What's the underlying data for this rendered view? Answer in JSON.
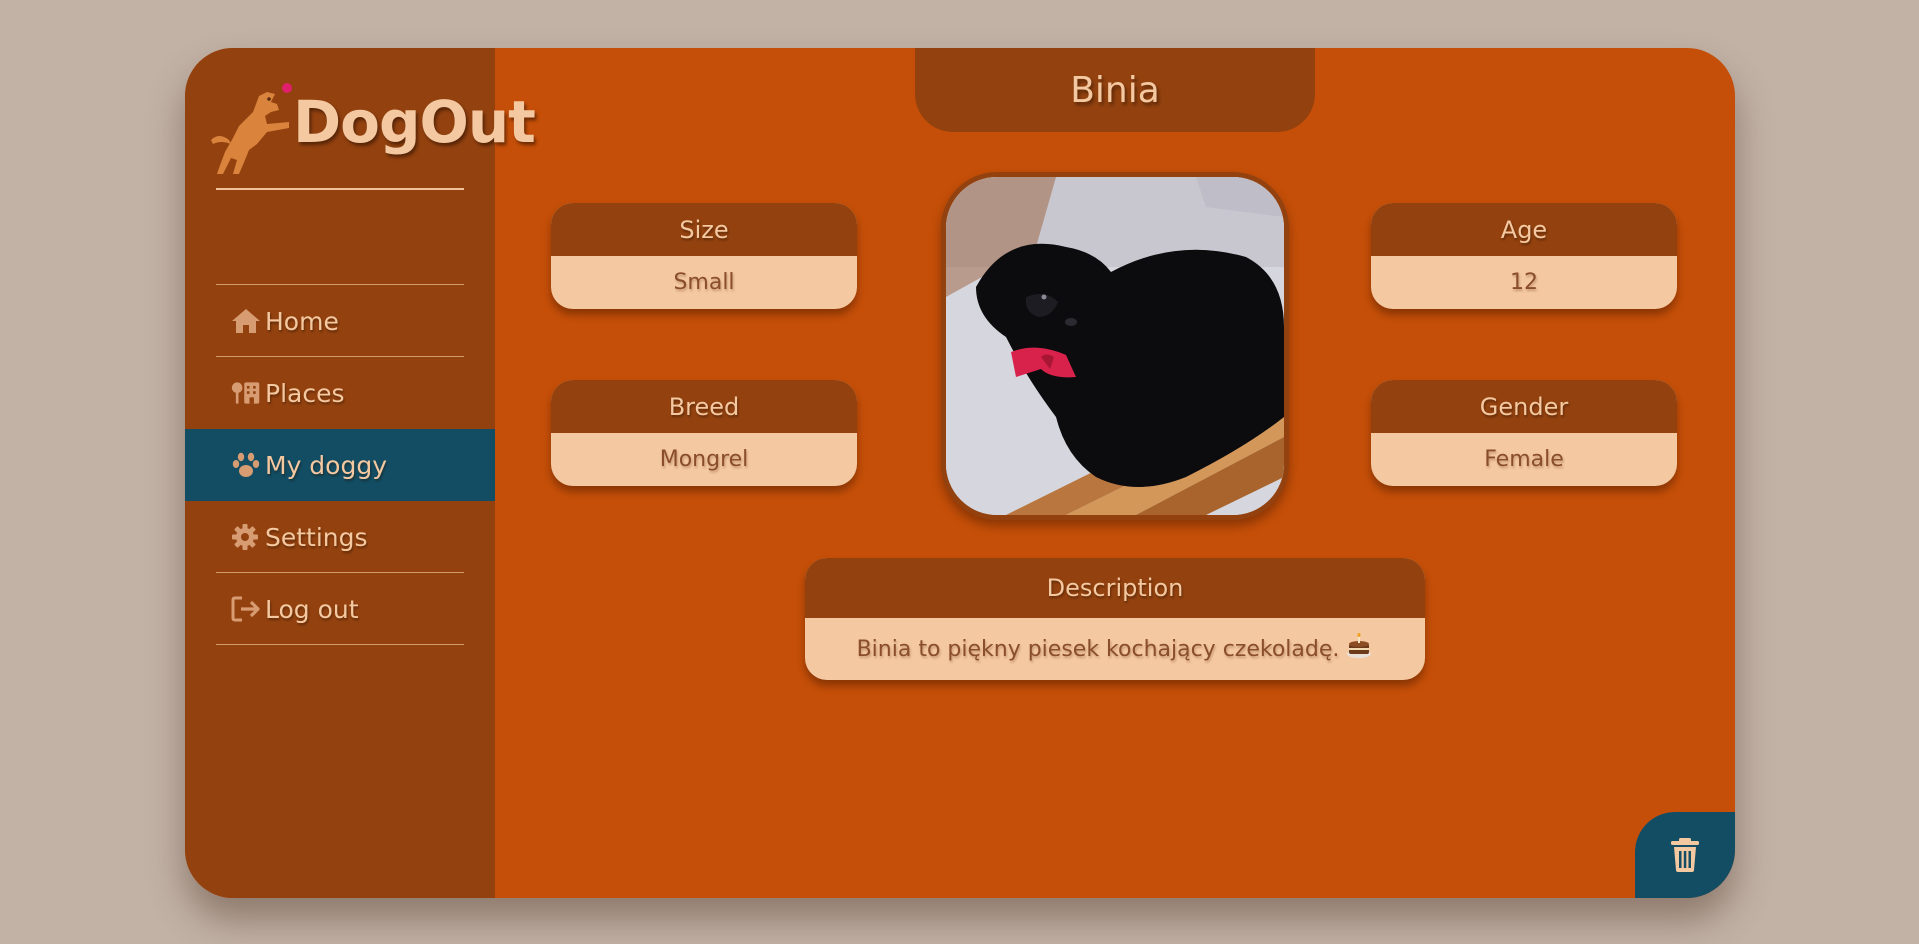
{
  "app": {
    "brand": "DogOut"
  },
  "sidebar": {
    "items": [
      {
        "label": "Home",
        "icon": "home-icon"
      },
      {
        "label": "Places",
        "icon": "places-icon"
      },
      {
        "label": "My doggy",
        "icon": "paw-icon",
        "active": true
      },
      {
        "label": "Settings",
        "icon": "gear-icon"
      },
      {
        "label": "Log out",
        "icon": "logout-icon"
      }
    ]
  },
  "dog": {
    "name": "Binia",
    "size": {
      "label": "Size",
      "value": "Small"
    },
    "breed": {
      "label": "Breed",
      "value": "Mongrel"
    },
    "age": {
      "label": "Age",
      "value": "12"
    },
    "gender": {
      "label": "Gender",
      "value": "Female"
    },
    "description": {
      "label": "Description",
      "value": "Binia to piękny piesek kochający czekoladę."
    }
  },
  "actions": {
    "delete_icon": "trash-icon"
  },
  "colors": {
    "background": "#c2b2a6",
    "panel": "#c54f08",
    "sidebar": "#93420f",
    "active": "#124d63",
    "text_light": "#f4c8a0"
  }
}
